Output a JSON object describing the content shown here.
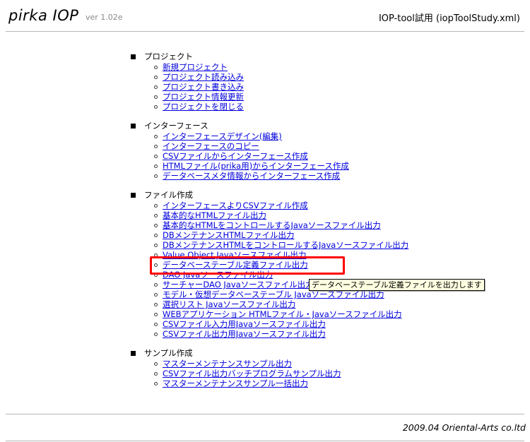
{
  "header": {
    "app_name": "pirka IOP",
    "version": "ver 1.02e",
    "project_title": "IOP-tool試用 (iopToolStudy.xml)"
  },
  "sections": {
    "project": {
      "title": "プロジェクト",
      "items": [
        "新規プロジェクト",
        "プロジェクト読み込み",
        "プロジェクト書き込み",
        "プロジェクト情報更新",
        "プロジェクトを閉じる"
      ]
    },
    "interface": {
      "title": "インターフェース",
      "items": [
        "インターフェースデザイン(編集)",
        "インターフェースのコピー",
        "CSVファイルからインターフェース作成",
        "HTMLファイル(prika用)からインターフェース作成",
        "データベースメタ情報からインターフェース作成"
      ]
    },
    "file": {
      "title": "ファイル作成",
      "items": [
        "インターフェースよりCSVファイル作成",
        "基本的なHTMLファイル出力",
        "基本的なHTMLをコントロールするJavaソースファイル出力",
        "DBメンテナンスHTMLファイル出力",
        "DBメンテナンスHTMLをコントロールするJavaソースファイル出力",
        "Value Object Javaソースファイル出力",
        "データベーステーブル定義ファイル出力",
        "DAO Javaソースファイル出力",
        "サーチャーDAO Javaソースファイル出力",
        "モデル・仮想データベーステーブル Javaソースファイル出力",
        "選択リスト Javaソースファイル出力",
        "WEBアプリケーション HTMLファイル・Javaソースファイル出力",
        "CSVファイル入力用Javaソースファイル出力",
        "CSVファイル出力用Javaソースファイル出力"
      ]
    },
    "sample": {
      "title": "サンプル作成",
      "items": [
        "マスターメンテナンスサンプル出力",
        "CSVファイル出力バッチプログラムサンプル出力",
        "マスターメンテナンスサンプル一括出力"
      ]
    }
  },
  "tooltip": {
    "text": "データベーステーブル定義ファイルを出力します"
  },
  "footer": {
    "copyright": "2009.04 Oriental-Arts co.ltd"
  },
  "colors": {
    "link": "#0000dd",
    "highlight": "#ff0000",
    "tooltip_bg": "#ffffe1"
  }
}
